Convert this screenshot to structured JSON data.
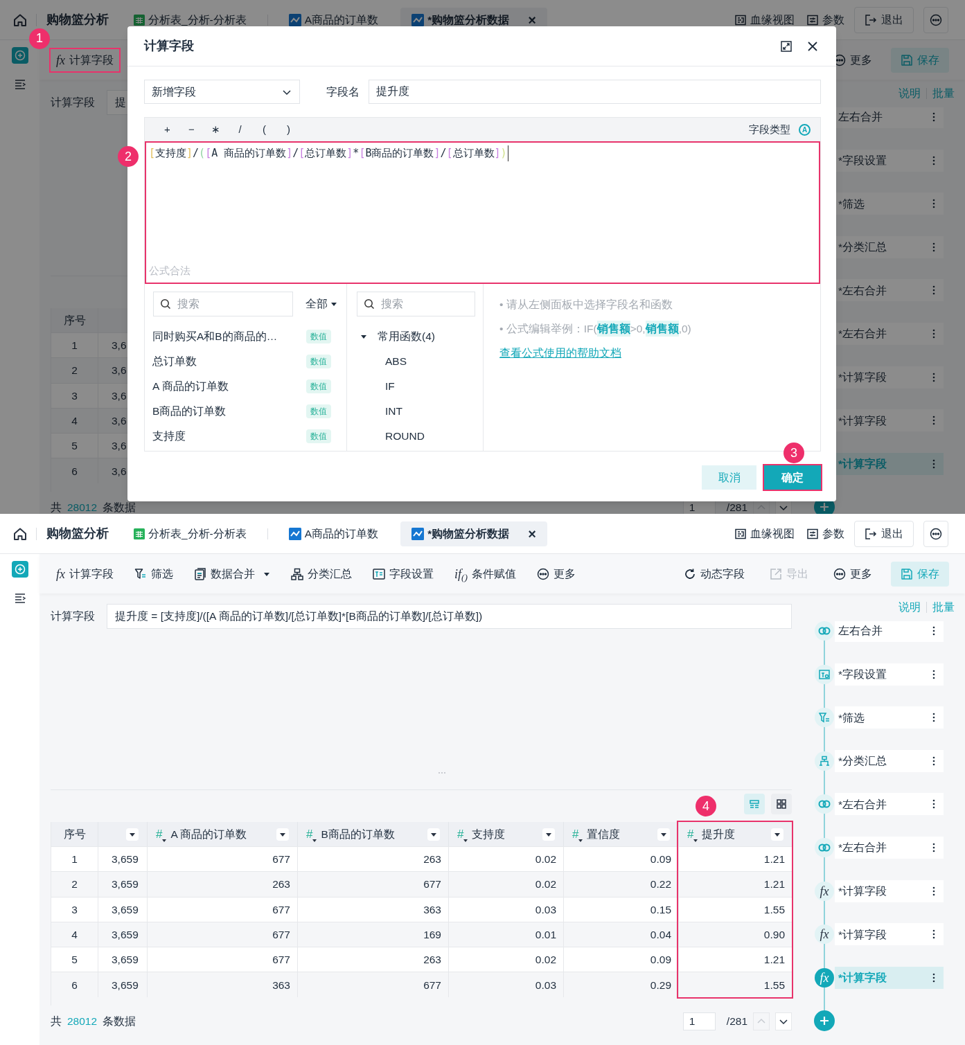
{
  "screens": [
    {
      "app": {
        "header": {
          "title": "购物篮分析",
          "tabs": [
            {
              "label": "分析表_分析-分析表",
              "kind": "table",
              "selected": false
            },
            {
              "label": "A商品的订单数",
              "kind": "chart",
              "selected": false
            },
            {
              "label": "*购物篮分析数据",
              "kind": "chart",
              "selected": true,
              "close": "×"
            }
          ],
          "actions": [
            {
              "label": "血缘视图",
              "kind": "lineage"
            },
            {
              "label": "参数",
              "kind": "params"
            },
            {
              "label": "退出",
              "kind": "exit"
            }
          ]
        },
        "toolbar": {
          "left": [
            {
              "label": "计算字段",
              "kind": "fx",
              "icon_text": "fx",
              "callout": "1",
              "disabled": false
            }
          ],
          "right": [
            {
              "label": "更多",
              "kind": "more",
              "disabled": false
            },
            {
              "label": "保存",
              "kind": "save",
              "disabled": false
            }
          ]
        },
        "formula_bar": {
          "label": "计算字段",
          "value": "提"
        },
        "table": {
          "columns": [
            {
              "label": "序号",
              "kind": "index"
            },
            {
              "kind": "cut"
            }
          ],
          "rows": [
            [
              "1",
              "3,6"
            ],
            [
              "2",
              "3,6"
            ],
            [
              "3",
              "3,6"
            ],
            [
              "4",
              "3,6"
            ],
            [
              "5",
              "3,6"
            ],
            [
              "6",
              "3,6"
            ]
          ]
        },
        "footer": {
          "prefix": "共",
          "count": "28012",
          "suffix": "条数据",
          "page": "1",
          "pages": "/281"
        },
        "sidebar": {
          "links": [
            "说明",
            "批量"
          ],
          "steps": [
            {
              "label": "左右合并",
              "selected": false
            },
            {
              "label": "*字段设置",
              "selected": false
            },
            {
              "label": "*筛选",
              "selected": false
            },
            {
              "label": "*分类汇总",
              "selected": false
            },
            {
              "label": "*左右合并",
              "selected": false
            },
            {
              "label": "*左右合并",
              "selected": false
            },
            {
              "label": "*计算字段",
              "selected": false
            },
            {
              "label": "*计算字段",
              "selected": false
            },
            {
              "label": "*计算字段",
              "selected": true
            }
          ]
        }
      },
      "dialog": {
        "title": "计算字段",
        "mode": "新增字段",
        "name_label": "字段名",
        "name_value": "提升度",
        "operators": [
          "+",
          "−",
          "∗",
          "/",
          "(",
          ")"
        ],
        "type_label": "字段类型",
        "type_icon": "A",
        "formula": [
          {
            "text": "[",
            "color": "#e2be5a"
          },
          {
            "text": "支持度"
          },
          {
            "text": "]",
            "color": "#e2be5a"
          },
          {
            "text": "/"
          },
          {
            "text": "(",
            "color": "#8fd3a0"
          },
          {
            "text": "[",
            "color": "#c77ee0"
          },
          {
            "text": "A 商品的订单数"
          },
          {
            "text": "]",
            "color": "#c77ee0"
          },
          {
            "text": "/"
          },
          {
            "text": "[",
            "color": "#c77ee0"
          },
          {
            "text": "总订单数"
          },
          {
            "text": "]",
            "color": "#c77ee0"
          },
          {
            "text": "*"
          },
          {
            "text": "[",
            "color": "#c77ee0"
          },
          {
            "text": "B商品的订单数"
          },
          {
            "text": "]",
            "color": "#c77ee0"
          },
          {
            "text": "/"
          },
          {
            "text": "[",
            "color": "#c77ee0"
          },
          {
            "text": "总订单数"
          },
          {
            "text": "]",
            "color": "#c77ee0"
          },
          {
            "text": ")",
            "color": "#cfe08a"
          }
        ],
        "status": "公式合法",
        "editor_callout": "2",
        "fields": {
          "search_placeholder": "搜索",
          "filter": "全部",
          "items": [
            {
              "label": "同时购买A和B的商品的…",
              "tag": "数值"
            },
            {
              "label": "总订单数",
              "tag": "数值"
            },
            {
              "label": "A 商品的订单数",
              "tag": "数值"
            },
            {
              "label": "B商品的订单数",
              "tag": "数值"
            },
            {
              "label": "支持度",
              "tag": "数值"
            }
          ]
        },
        "functions": {
          "search_placeholder": "搜索",
          "tree": [
            {
              "label": "常用函数(4)",
              "expanded": true,
              "children": [
                {
                  "label": "ABS"
                },
                {
                  "label": "IF"
                },
                {
                  "label": "INT"
                },
                {
                  "label": "ROUND"
                }
              ]
            }
          ]
        },
        "hints": [
          {
            "parts": [
              {
                "text": "• 请从左侧面板中选择字段名和函数"
              }
            ]
          },
          {
            "parts": [
              {
                "text": "• 公式编辑举例：IF("
              },
              {
                "text": "销售额",
                "kind": "field"
              },
              {
                "text": ">0,"
              },
              {
                "text": "销售额",
                "kind": "field"
              },
              {
                "text": ",0)"
              }
            ]
          }
        ],
        "help_link": "查看公式使用的帮助文档",
        "buttons": [
          {
            "label": "取消",
            "kind": "secondary"
          },
          {
            "label": "确定",
            "kind": "primary",
            "callout": "3"
          }
        ]
      }
    },
    {
      "app": {
        "header": {
          "title": "购物篮分析",
          "tabs": [
            {
              "label": "分析表_分析-分析表",
              "kind": "table",
              "selected": false
            },
            {
              "label": "A商品的订单数",
              "kind": "chart",
              "selected": false
            },
            {
              "label": "*购物篮分析数据",
              "kind": "chart",
              "selected": true,
              "close": "×"
            }
          ],
          "actions": [
            {
              "label": "血缘视图",
              "kind": "lineage"
            },
            {
              "label": "参数",
              "kind": "params"
            },
            {
              "label": "退出",
              "kind": "exit"
            }
          ]
        },
        "toolbar": {
          "left": [
            {
              "label": "计算字段",
              "kind": "fx",
              "icon_text": "fx",
              "disabled": false
            },
            {
              "label": "筛选",
              "kind": "filter",
              "disabled": false
            },
            {
              "label": "数据合并",
              "kind": "merge",
              "disabled": false
            },
            {
              "label": "分类汇总",
              "kind": "group",
              "disabled": false
            },
            {
              "label": "字段设置",
              "kind": "fieldset",
              "disabled": false
            },
            {
              "label": "条件赋值",
              "kind": "if",
              "icon_text": "if$_{()}$",
              "disabled": false
            },
            {
              "label": "更多",
              "kind": "more",
              "disabled": false
            }
          ],
          "right": [
            {
              "label": "动态字段",
              "kind": "dynamic",
              "disabled": false
            },
            {
              "label": "导出",
              "kind": "export",
              "disabled": true
            },
            {
              "label": "更多",
              "kind": "more",
              "disabled": false
            },
            {
              "label": "保存",
              "kind": "save",
              "disabled": false
            }
          ]
        },
        "formula_bar": {
          "label": "计算字段",
          "value": "提升度 = [支持度]/([A 商品的订单数]/[总订单数]*[B商品的订单数]/[总订单数])"
        },
        "resize_handle": true,
        "view_switch": [
          {
            "kind": "list",
            "selected": true
          },
          {
            "kind": "grid",
            "selected": false
          }
        ],
        "table": {
          "columns": [
            {
              "label": "序号",
              "kind": "index"
            },
            {
              "kind": "cut",
              "dropdown": true
            },
            {
              "label": "A 商品的订单数",
              "kind": "number",
              "type_icon": "#",
              "dropdown": true
            },
            {
              "label": "B商品的订单数",
              "kind": "number",
              "type_icon": "#",
              "dropdown": true
            },
            {
              "label": "支持度",
              "kind": "number",
              "type_icon": "#",
              "dropdown": true
            },
            {
              "label": "置信度",
              "kind": "number",
              "type_icon": "#",
              "dropdown": true
            },
            {
              "label": "提升度",
              "kind": "number",
              "type_icon": "#",
              "dropdown": true,
              "callout": "4"
            }
          ],
          "rows": [
            [
              "1",
              "3,659",
              "677",
              "263",
              "0.02",
              "0.09",
              "1.21"
            ],
            [
              "2",
              "3,659",
              "263",
              "677",
              "0.02",
              "0.22",
              "1.21"
            ],
            [
              "3",
              "3,659",
              "677",
              "363",
              "0.03",
              "0.15",
              "1.55"
            ],
            [
              "4",
              "3,659",
              "677",
              "169",
              "0.01",
              "0.04",
              "0.90"
            ],
            [
              "5",
              "3,659",
              "677",
              "263",
              "0.02",
              "0.09",
              "1.21"
            ],
            [
              "6",
              "3,659",
              "363",
              "677",
              "0.03",
              "0.29",
              "1.55"
            ]
          ]
        },
        "footer": {
          "prefix": "共",
          "count": "28012",
          "suffix": "条数据",
          "page": "1",
          "pages": "/281"
        },
        "sidebar": {
          "links": [
            "说明",
            "批量"
          ],
          "steps": [
            {
              "label": "左右合并",
              "kind": "merge",
              "selected": false
            },
            {
              "label": "*字段设置",
              "kind": "fieldset",
              "selected": false
            },
            {
              "label": "*筛选",
              "kind": "filter",
              "selected": false
            },
            {
              "label": "*分类汇总",
              "kind": "group",
              "selected": false
            },
            {
              "label": "*左右合并",
              "kind": "merge",
              "selected": false
            },
            {
              "label": "*左右合并",
              "kind": "merge",
              "selected": false
            },
            {
              "label": "*计算字段",
              "kind": "calc",
              "icon_text": "fx",
              "selected": false
            },
            {
              "label": "*计算字段",
              "kind": "calc",
              "icon_text": "fx",
              "selected": false
            },
            {
              "label": "*计算字段",
              "kind": "calc",
              "icon_text": "fx",
              "selected": true
            }
          ]
        }
      }
    }
  ]
}
